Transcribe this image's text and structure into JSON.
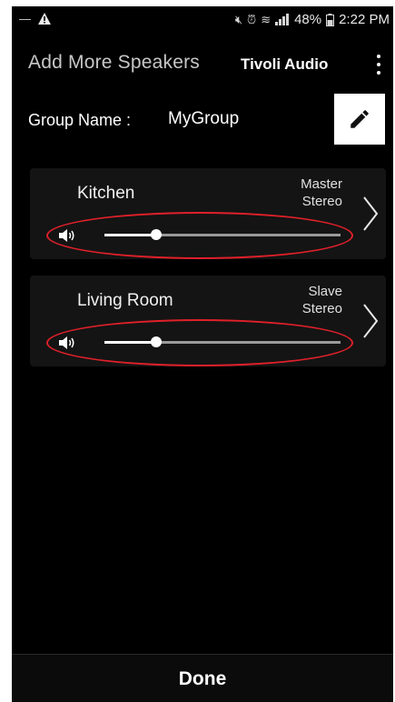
{
  "status_bar": {
    "time": "2:22 PM",
    "battery": "48%",
    "icons": [
      "minus-icon",
      "warning-icon",
      "mute-icon",
      "alarm-icon",
      "wifi-icon",
      "signal-icon",
      "battery-icon"
    ]
  },
  "header": {
    "title": "Add More Speakers",
    "brand": "Tivoli Audio",
    "overflow_icon": "overflow-menu-icon"
  },
  "group": {
    "label": "Group Name :",
    "value": "MyGroup",
    "edit_icon": "pencil-icon"
  },
  "speakers": [
    {
      "name": "Kitchen",
      "role_line1": "Master",
      "role_line2": "Stereo",
      "volume": 0.22
    },
    {
      "name": "Living Room",
      "role_line1": "Slave",
      "role_line2": "Stereo",
      "volume": 0.22
    }
  ],
  "footer": {
    "done_label": "Done"
  },
  "colors": {
    "background": "#000000",
    "card": "#141414",
    "annotation": "#e0202a",
    "track": "#9a9a9a"
  }
}
